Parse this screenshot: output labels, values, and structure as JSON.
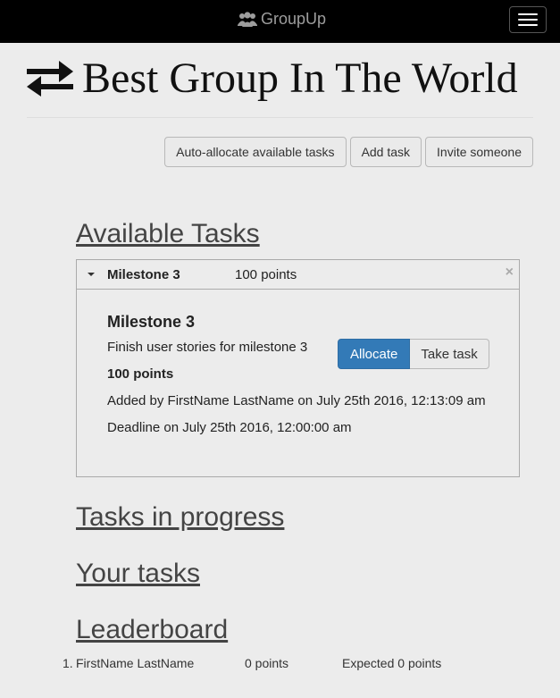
{
  "navbar": {
    "brand": "GroupUp",
    "brand_icon": "users-icon",
    "menu_icon": "hamburger-icon"
  },
  "group": {
    "title": "Best Group In The World",
    "icon": "exchange-arrows-icon"
  },
  "actions": {
    "auto_allocate": "Auto-allocate available tasks",
    "add_task": "Add task",
    "invite": "Invite someone"
  },
  "sections": {
    "available": "Available Tasks",
    "in_progress": "Tasks in progress",
    "yours": "Your tasks",
    "leaderboard": "Leaderboard"
  },
  "task": {
    "header_title": "Milestone 3",
    "header_points": "100 points",
    "close": "×",
    "title": "Milestone 3",
    "description": "Finish user stories for milestone 3",
    "points": "100 points",
    "added_by": "Added by FirstName LastName on July 25th 2016, 12:13:09 am",
    "deadline": "Deadline on July 25th 2016, 12:00:00 am",
    "allocate_label": "Allocate",
    "take_label": "Take task"
  },
  "leaderboard": [
    {
      "rank": "1.",
      "name": "FirstName LastName",
      "points": "0 points",
      "expected": "Expected 0 points"
    }
  ],
  "colors": {
    "primary": "#337ab7",
    "navbar": "#000000",
    "background": "#ececec"
  }
}
